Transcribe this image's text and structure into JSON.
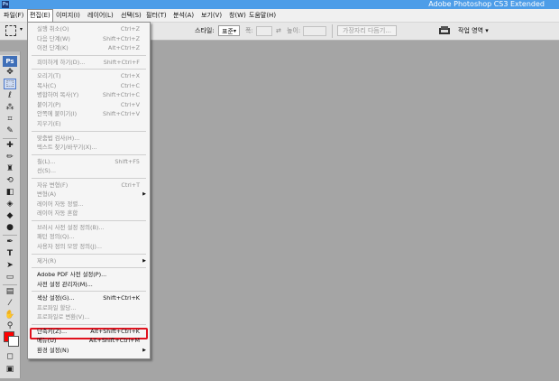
{
  "window": {
    "title": "Adobe Photoshop CS3 Extended",
    "app_badge": "Ps"
  },
  "menubar": {
    "items": [
      {
        "label": "파일(F)"
      },
      {
        "label": "편집(E)"
      },
      {
        "label": "이미지(I)"
      },
      {
        "label": "레이어(L)"
      },
      {
        "label": "선택(S)"
      },
      {
        "label": "필터(T)"
      },
      {
        "label": "분석(A)"
      },
      {
        "label": "보기(V)"
      },
      {
        "label": "창(W)"
      },
      {
        "label": "도움말(H)"
      }
    ],
    "active_index": 1
  },
  "options_bar": {
    "style_label": "스타일:",
    "style_value": "표준",
    "width_label": "폭:",
    "height_label": "높이:",
    "refine_button": "가장자리 다듬기...",
    "workspace_label": "작업 영역 ▾"
  },
  "toolbox": {
    "logo": "Ps",
    "foreground_color": "#ff0000",
    "background_color": "#ffffff"
  },
  "edit_menu": {
    "items": [
      {
        "label": "실행 취소(O)",
        "shortcut": "Ctrl+Z",
        "enabled": false
      },
      {
        "label": "다음 단계(W)",
        "shortcut": "Shift+Ctrl+Z",
        "enabled": false
      },
      {
        "label": "이전 단계(K)",
        "shortcut": "Alt+Ctrl+Z",
        "enabled": false
      },
      {
        "separator": true
      },
      {
        "label": "희미하게 하기(D)...",
        "shortcut": "Shift+Ctrl+F",
        "enabled": false
      },
      {
        "separator": true
      },
      {
        "label": "오리기(T)",
        "shortcut": "Ctrl+X",
        "enabled": false
      },
      {
        "label": "복사(C)",
        "shortcut": "Ctrl+C",
        "enabled": false
      },
      {
        "label": "병합하여 복사(Y)",
        "shortcut": "Shift+Ctrl+C",
        "enabled": false
      },
      {
        "label": "붙이기(P)",
        "shortcut": "Ctrl+V",
        "enabled": false
      },
      {
        "label": "안쪽에 붙이기(I)",
        "shortcut": "Shift+Ctrl+V",
        "enabled": false
      },
      {
        "label": "지우기(E)",
        "shortcut": "",
        "enabled": false
      },
      {
        "separator": true
      },
      {
        "label": "맞춤법 검사(H)...",
        "shortcut": "",
        "enabled": false
      },
      {
        "label": "텍스트 찾기/바꾸기(X)...",
        "shortcut": "",
        "enabled": false
      },
      {
        "separator": true
      },
      {
        "label": "칠(L)...",
        "shortcut": "Shift+F5",
        "enabled": false
      },
      {
        "label": "선(S)...",
        "shortcut": "",
        "enabled": false
      },
      {
        "separator": true
      },
      {
        "label": "자유 변형(F)",
        "shortcut": "Ctrl+T",
        "enabled": false
      },
      {
        "label": "변형(A)",
        "shortcut": "",
        "enabled": false,
        "submenu": true
      },
      {
        "label": "레이어 자동 정렬...",
        "shortcut": "",
        "enabled": false
      },
      {
        "label": "레이어 자동 혼합",
        "shortcut": "",
        "enabled": false
      },
      {
        "separator": true
      },
      {
        "label": "브러시 사전 설정 정의(B)...",
        "shortcut": "",
        "enabled": false
      },
      {
        "label": "패턴 정의(Q)...",
        "shortcut": "",
        "enabled": false
      },
      {
        "label": "사용자 정의 모양 정의(J)...",
        "shortcut": "",
        "enabled": false
      },
      {
        "separator": true
      },
      {
        "label": "제거(R)",
        "shortcut": "",
        "enabled": false,
        "submenu": true
      },
      {
        "separator": true
      },
      {
        "label": "Adobe PDF 사전 설정(P)...",
        "shortcut": "",
        "enabled": true
      },
      {
        "label": "사전 설정 관리자(M)...",
        "shortcut": "",
        "enabled": true
      },
      {
        "separator": true
      },
      {
        "label": "색상 설정(G)...",
        "shortcut": "Shift+Ctrl+K",
        "enabled": true
      },
      {
        "label": "프로파일 할당...",
        "shortcut": "",
        "enabled": false
      },
      {
        "label": "프로파일로 변환(V)...",
        "shortcut": "",
        "enabled": false
      },
      {
        "separator": true
      },
      {
        "label": "단축키(Z)...",
        "shortcut": "Alt+Shift+Ctrl+K",
        "enabled": true,
        "highlighted": true
      },
      {
        "label": "메뉴(U)",
        "shortcut": "Alt+Shift+Ctrl+M",
        "enabled": true
      },
      {
        "label": "환경 설정(N)",
        "shortcut": "",
        "enabled": true,
        "submenu": true
      }
    ]
  }
}
